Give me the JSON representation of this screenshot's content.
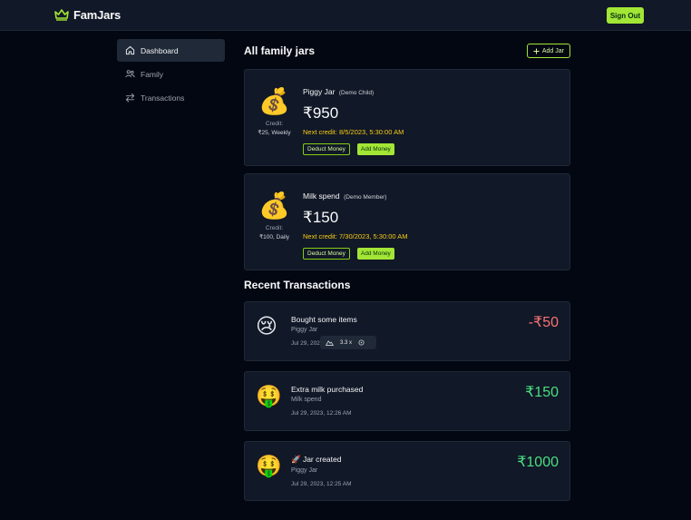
{
  "app": {
    "title": "FamJars",
    "sign_out_label": "Sign Out"
  },
  "colors": {
    "accent": "#a3e635",
    "background": "#030712",
    "card": "#111827",
    "warning": "#facc15",
    "negative": "#f87171",
    "positive": "#4ade80"
  },
  "sidebar": {
    "items": [
      {
        "label": "Dashboard",
        "icon": "home-icon",
        "active": true
      },
      {
        "label": "Family",
        "icon": "family-icon",
        "active": false
      },
      {
        "label": "Transactions",
        "icon": "transfer-icon",
        "active": false
      }
    ]
  },
  "main": {
    "title": "All family jars",
    "add_jar_label": "Add Jar",
    "jars": [
      {
        "emoji": "💰",
        "name": "Piggy Jar",
        "owner": "(Demo Child)",
        "balance": "₹950",
        "credit_label": "Credit:",
        "credit_value": "₹25, Weekly",
        "next_credit": "Next credit: 8/5/2023, 5:30:00 AM",
        "deduct_label": "Deduct Money",
        "add_label": "Add Money"
      },
      {
        "emoji": "💰",
        "name": "Milk spend",
        "owner": "(Demo Member)",
        "balance": "₹150",
        "credit_label": "Credit:",
        "credit_value": "₹100, Daily",
        "next_credit": "Next credit: 7/30/2023, 5:30:00 AM",
        "deduct_label": "Deduct Money",
        "add_label": "Add Money"
      }
    ],
    "recent_title": "Recent Transactions",
    "transactions": [
      {
        "emoji": "😢",
        "title": "Bought some items",
        "jar": "Piggy Jar",
        "date": "Jul 29, 2023, 12:27 AM",
        "amount": "-₹50",
        "type": "neg"
      },
      {
        "emoji": "🤑",
        "title": "Extra milk purchased",
        "jar": "Milk spend",
        "date": "Jul 29, 2023, 12:26 AM",
        "amount": "₹150",
        "type": "pos"
      },
      {
        "emoji": "🤑",
        "title": "🚀 Jar created",
        "jar": "Piggy Jar",
        "date": "Jul 29, 2023, 12:25 AM",
        "amount": "₹1000",
        "type": "pos"
      }
    ]
  },
  "overlay": {
    "zoom_value": "3.3",
    "zoom_unit": "x"
  }
}
